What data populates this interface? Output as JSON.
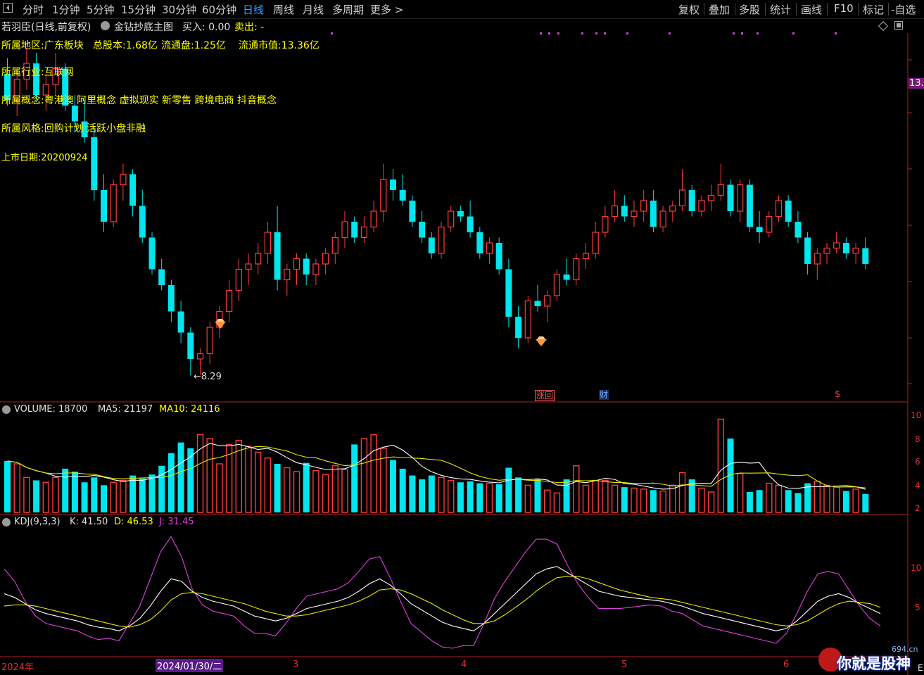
{
  "toolbar": {
    "back_icon": "back-square-icon",
    "tabs": [
      "分时",
      "1分钟",
      "5分钟",
      "15分钟",
      "30分钟",
      "60分钟",
      "日线",
      "周线",
      "月线",
      "多周期",
      "更多 >"
    ],
    "active_tab": "日线",
    "right_tabs": [
      "复权",
      "叠加",
      "多股",
      "统计",
      "画线",
      "F10",
      "标记",
      "-自选"
    ]
  },
  "title": {
    "stock": "若羽臣(日线,前复权)",
    "indicator": "金钻抄底主图",
    "buy": "买入: 0.00",
    "sell": "卖出: -"
  },
  "info": {
    "region": "所属地区:广东板块",
    "total_shares": "总股本:1.68亿",
    "float_shares": "流通盘:1.25亿",
    "float_value": "流通市值:13.36亿",
    "industry": "所属行业:互联网",
    "concepts": "所属概念:粤港澳 阿里概念 虚拟现实 新零售 跨境电商 抖音概念",
    "style": "所属风格:回购计划 活跃小盘非融",
    "listing": "上市日期:20200924"
  },
  "price_panel": {
    "low_label": "←8.29",
    "right_tag": "13.",
    "tags": [
      {
        "text": "涨回",
        "color": "#ff5a5a"
      },
      {
        "text": "财",
        "color": "#6ab0ff"
      },
      {
        "text": "$",
        "color": "#ff3030"
      }
    ]
  },
  "volume_panel": {
    "label": "VOLUME: 18700",
    "ma5": "MA5: 21197",
    "ma10": "MA10: 24116",
    "y_ticks": [
      "10",
      "8",
      "6",
      "4",
      "2"
    ]
  },
  "kdj_panel": {
    "label": "KDJ(9,3,3)",
    "k": "K: 41.50",
    "d": "D: 46.53",
    "j": "J: 31.45",
    "y_ticks": [
      "10",
      "5"
    ]
  },
  "date_axis": {
    "year": "2024年",
    "cursor": "2024/01/30/二",
    "months": [
      "3",
      "4",
      "5",
      "6"
    ],
    "corner": "E"
  },
  "watermark": {
    "brand": "你就是股神",
    "domain": "694.cn"
  },
  "colors": {
    "up": "#ff3b3b",
    "down": "#00e5ee",
    "ma5": "#ffffff",
    "ma10": "#e8e800",
    "j": "#e040e0",
    "active_tab": "#3aa0ff",
    "info_text": "#ffff00"
  },
  "chart_data": {
    "type": "candlestick",
    "price_low_marked": 8.29,
    "candles": [
      [
        14.0,
        14.3,
        13.4,
        13.5
      ],
      [
        13.5,
        14.1,
        13.2,
        13.9
      ],
      [
        13.9,
        14.5,
        13.7,
        14.2
      ],
      [
        14.2,
        14.4,
        13.5,
        13.6
      ],
      [
        13.6,
        14.0,
        13.3,
        13.8
      ],
      [
        13.8,
        14.4,
        13.6,
        14.1
      ],
      [
        14.1,
        14.2,
        13.3,
        13.4
      ],
      [
        13.4,
        13.6,
        12.9,
        13.1
      ],
      [
        13.1,
        13.5,
        12.7,
        12.8
      ],
      [
        12.8,
        13.0,
        11.6,
        11.8
      ],
      [
        11.8,
        12.1,
        11.0,
        11.2
      ],
      [
        11.2,
        12.0,
        11.1,
        11.9
      ],
      [
        11.9,
        12.3,
        11.6,
        12.1
      ],
      [
        12.1,
        12.2,
        11.3,
        11.5
      ],
      [
        11.5,
        11.8,
        10.8,
        10.9
      ],
      [
        10.9,
        11.0,
        10.2,
        10.3
      ],
      [
        10.3,
        10.5,
        9.9,
        10.0
      ],
      [
        10.0,
        10.1,
        9.3,
        9.5
      ],
      [
        9.5,
        9.7,
        8.9,
        9.1
      ],
      [
        9.1,
        9.2,
        8.29,
        8.6
      ],
      [
        8.6,
        8.8,
        8.3,
        8.7
      ],
      [
        8.7,
        9.3,
        8.5,
        9.2
      ],
      [
        9.2,
        9.6,
        9.0,
        9.5
      ],
      [
        9.5,
        10.1,
        9.3,
        9.9
      ],
      [
        9.9,
        10.5,
        9.7,
        10.3
      ],
      [
        10.3,
        10.6,
        10.0,
        10.4
      ],
      [
        10.4,
        10.8,
        10.2,
        10.6
      ],
      [
        10.6,
        11.2,
        10.4,
        11.0
      ],
      [
        11.0,
        11.5,
        9.9,
        10.1
      ],
      [
        10.1,
        10.4,
        9.8,
        10.3
      ],
      [
        10.3,
        10.6,
        10.0,
        10.5
      ],
      [
        10.5,
        10.6,
        10.0,
        10.2
      ],
      [
        10.2,
        10.5,
        10.0,
        10.4
      ],
      [
        10.4,
        10.7,
        10.2,
        10.6
      ],
      [
        10.6,
        11.0,
        10.4,
        10.9
      ],
      [
        10.9,
        11.4,
        10.7,
        11.2
      ],
      [
        11.2,
        11.3,
        10.8,
        10.9
      ],
      [
        10.9,
        11.3,
        10.8,
        11.1
      ],
      [
        11.1,
        11.6,
        11.0,
        11.4
      ],
      [
        11.4,
        12.3,
        11.2,
        12.0
      ],
      [
        12.0,
        12.2,
        11.6,
        11.8
      ],
      [
        11.8,
        12.1,
        11.5,
        11.6
      ],
      [
        11.6,
        11.7,
        11.1,
        11.2
      ],
      [
        11.2,
        11.4,
        10.8,
        10.9
      ],
      [
        10.9,
        11.0,
        10.5,
        10.6
      ],
      [
        10.6,
        11.2,
        10.5,
        11.1
      ],
      [
        11.1,
        11.5,
        11.0,
        11.4
      ],
      [
        11.4,
        11.5,
        11.2,
        11.3
      ],
      [
        11.3,
        11.6,
        10.9,
        11.0
      ],
      [
        11.0,
        11.1,
        10.5,
        10.6
      ],
      [
        10.6,
        10.9,
        10.4,
        10.8
      ],
      [
        10.8,
        10.9,
        10.2,
        10.3
      ],
      [
        10.3,
        10.5,
        9.2,
        9.4
      ],
      [
        9.4,
        9.6,
        8.8,
        9.0
      ],
      [
        9.0,
        9.8,
        8.9,
        9.7
      ],
      [
        9.7,
        10.0,
        9.5,
        9.6
      ],
      [
        9.6,
        9.9,
        9.3,
        9.8
      ],
      [
        9.8,
        10.3,
        9.7,
        10.2
      ],
      [
        10.2,
        10.5,
        10.0,
        10.1
      ],
      [
        10.1,
        10.6,
        10.0,
        10.5
      ],
      [
        10.5,
        10.8,
        10.3,
        10.6
      ],
      [
        10.6,
        11.2,
        10.5,
        11.0
      ],
      [
        11.0,
        11.5,
        10.9,
        11.3
      ],
      [
        11.3,
        11.8,
        11.2,
        11.5
      ],
      [
        11.5,
        11.7,
        11.2,
        11.3
      ],
      [
        11.3,
        11.6,
        11.1,
        11.4
      ],
      [
        11.4,
        11.8,
        11.2,
        11.6
      ],
      [
        11.6,
        11.8,
        11.0,
        11.1
      ],
      [
        11.1,
        11.5,
        11.0,
        11.4
      ],
      [
        11.4,
        11.6,
        11.2,
        11.5
      ],
      [
        11.5,
        12.2,
        11.4,
        11.8
      ],
      [
        11.8,
        11.9,
        11.3,
        11.4
      ],
      [
        11.4,
        11.7,
        11.3,
        11.6
      ],
      [
        11.6,
        11.9,
        11.4,
        11.7
      ],
      [
        11.7,
        12.3,
        11.6,
        11.9
      ],
      [
        11.9,
        12.0,
        11.3,
        11.4
      ],
      [
        11.4,
        12.0,
        11.2,
        11.9
      ],
      [
        11.9,
        12.0,
        11.0,
        11.1
      ],
      [
        11.1,
        11.4,
        10.8,
        11.0
      ],
      [
        11.0,
        11.4,
        10.9,
        11.3
      ],
      [
        11.3,
        11.7,
        11.2,
        11.6
      ],
      [
        11.6,
        11.7,
        11.1,
        11.2
      ],
      [
        11.2,
        11.4,
        10.8,
        10.9
      ],
      [
        10.9,
        11.0,
        10.2,
        10.4
      ],
      [
        10.4,
        10.7,
        10.1,
        10.6
      ],
      [
        10.6,
        10.8,
        10.4,
        10.7
      ],
      [
        10.7,
        11.0,
        10.6,
        10.8
      ],
      [
        10.8,
        10.9,
        10.5,
        10.6
      ],
      [
        10.6,
        10.8,
        10.4,
        10.7
      ],
      [
        10.7,
        10.9,
        10.3,
        10.4
      ]
    ],
    "volume": [
      5.3,
      5.0,
      3.6,
      3.3,
      3.1,
      3.6,
      4.5,
      4.2,
      3.1,
      3.6,
      2.8,
      3.1,
      3.3,
      3.8,
      3.5,
      3.9,
      4.8,
      6.1,
      7.2,
      6.6,
      8.0,
      7.6,
      5.0,
      7.0,
      7.4,
      6.8,
      6.2,
      5.6,
      5.0,
      4.6,
      4.2,
      5.1,
      4.3,
      3.9,
      4.8,
      4.4,
      7.0,
      7.6,
      8.0,
      6.6,
      5.4,
      4.5,
      3.8,
      3.4,
      3.8,
      3.6,
      3.3,
      3.1,
      3.2,
      3.0,
      3.0,
      2.9,
      4.6,
      3.6,
      2.8,
      3.4,
      2.3,
      2.0,
      3.4,
      4.8,
      2.8,
      3.3,
      3.3,
      2.8,
      2.6,
      2.5,
      2.4,
      2.3,
      2.2,
      2.8,
      4.1,
      3.4,
      2.5,
      2.1,
      9.6,
      7.6,
      4.0,
      2.1,
      2.3,
      3.0,
      2.8,
      2.3,
      2.0,
      3.0,
      3.2,
      2.8,
      2.6,
      2.2,
      2.4,
      1.9
    ],
    "kdj": {
      "k": [
        58,
        55,
        50,
        45,
        42,
        40,
        38,
        36,
        33,
        31,
        30,
        28,
        32,
        38,
        48,
        60,
        70,
        68,
        60,
        55,
        52,
        50,
        48,
        44,
        40,
        38,
        36,
        38,
        42,
        46,
        48,
        50,
        52,
        55,
        60,
        66,
        70,
        65,
        58,
        50,
        45,
        40,
        35,
        32,
        30,
        28,
        34,
        42,
        50,
        58,
        66,
        74,
        78,
        80,
        75,
        70,
        65,
        60,
        58,
        56,
        55,
        54,
        53,
        52,
        50,
        48,
        45,
        42,
        40,
        38,
        36,
        34,
        32,
        30,
        28,
        30,
        36,
        44,
        52,
        56,
        58,
        55,
        50,
        46,
        42
      ],
      "d": [
        48,
        49,
        49,
        48,
        46,
        44,
        42,
        40,
        38,
        36,
        34,
        32,
        31,
        33,
        37,
        44,
        53,
        58,
        59,
        58,
        56,
        54,
        52,
        50,
        47,
        44,
        42,
        40,
        40,
        41,
        43,
        45,
        47,
        49,
        52,
        56,
        61,
        62,
        61,
        58,
        54,
        50,
        45,
        41,
        37,
        34,
        34,
        36,
        41,
        47,
        53,
        60,
        66,
        71,
        72,
        72,
        70,
        67,
        64,
        61,
        59,
        57,
        55,
        54,
        53,
        51,
        49,
        47,
        45,
        43,
        41,
        39,
        37,
        35,
        33,
        32,
        33,
        36,
        41,
        46,
        50,
        52,
        51,
        50,
        47
      ],
      "j": [
        78,
        68,
        52,
        40,
        34,
        32,
        30,
        28,
        24,
        21,
        22,
        20,
        34,
        48,
        70,
        92,
        104,
        88,
        62,
        49,
        44,
        42,
        40,
        32,
        26,
        26,
        24,
        34,
        46,
        56,
        58,
        60,
        62,
        67,
        76,
        86,
        88,
        71,
        52,
        34,
        27,
        20,
        15,
        14,
        16,
        16,
        34,
        54,
        68,
        80,
        92,
        102,
        102,
        98,
        81,
        66,
        55,
        46,
        46,
        46,
        47,
        48,
        49,
        48,
        44,
        42,
        37,
        32,
        30,
        28,
        26,
        24,
        22,
        20,
        18,
        26,
        42,
        60,
        74,
        76,
        74,
        61,
        48,
        38,
        32
      ]
    }
  }
}
